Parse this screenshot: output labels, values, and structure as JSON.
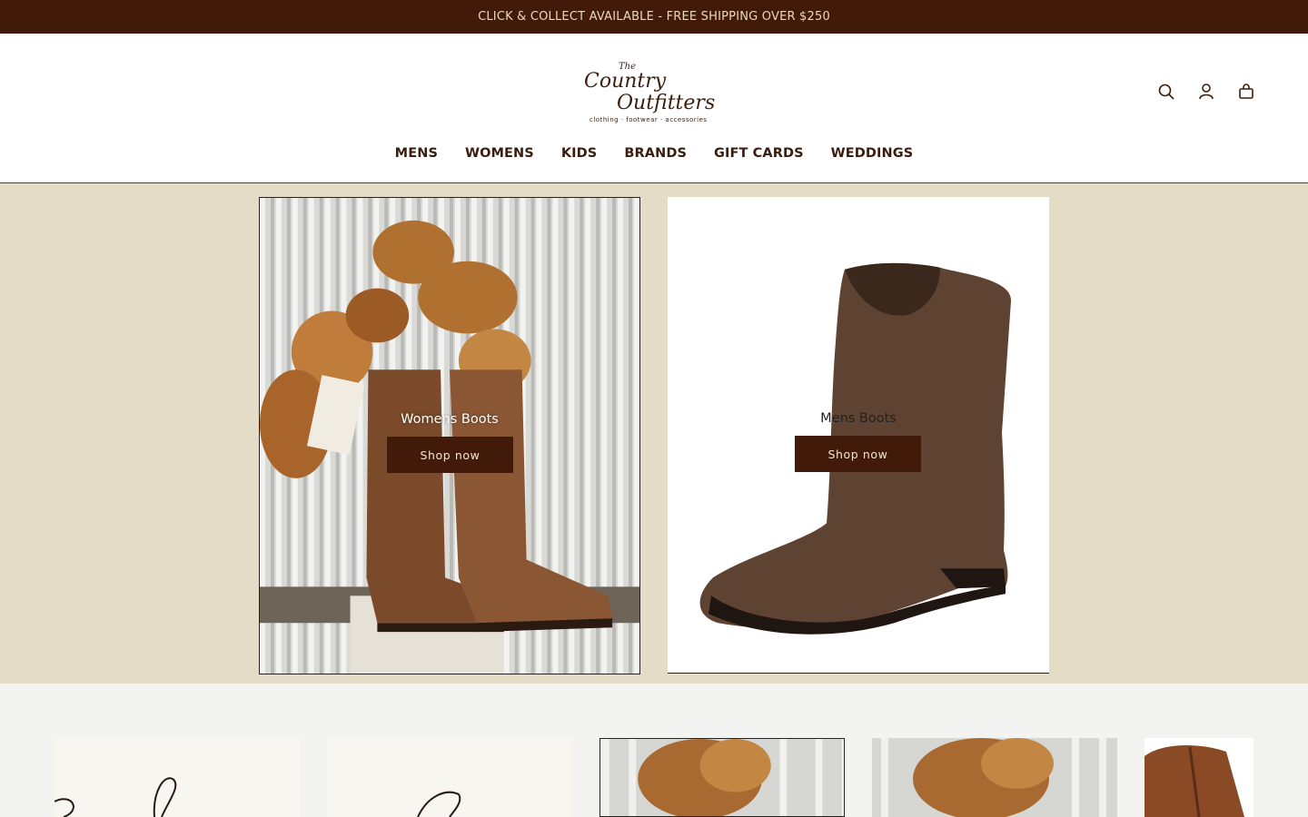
{
  "announcement": "CLICK & COLLECT AVAILABLE - FREE SHIPPING OVER $250",
  "logo": {
    "the": "The",
    "line1": "Country",
    "line2": "Outfitters",
    "tagline": "clothing · footwear · accessories"
  },
  "header_icons": [
    "search-icon",
    "account-icon",
    "cart-icon"
  ],
  "nav": [
    "MENS",
    "WOMENS",
    "KIDS",
    "BRANDS",
    "GIFT CARDS",
    "WEDDINGS"
  ],
  "hero": {
    "left": {
      "title": "Womens Boots",
      "button": "Shop now"
    },
    "right": {
      "title": "Mens Boots",
      "button": "Shop now"
    }
  },
  "colors": {
    "brand_dark": "#421a0a",
    "hero_bg": "#e5dcc7",
    "announce_text": "#ecd9b8"
  }
}
